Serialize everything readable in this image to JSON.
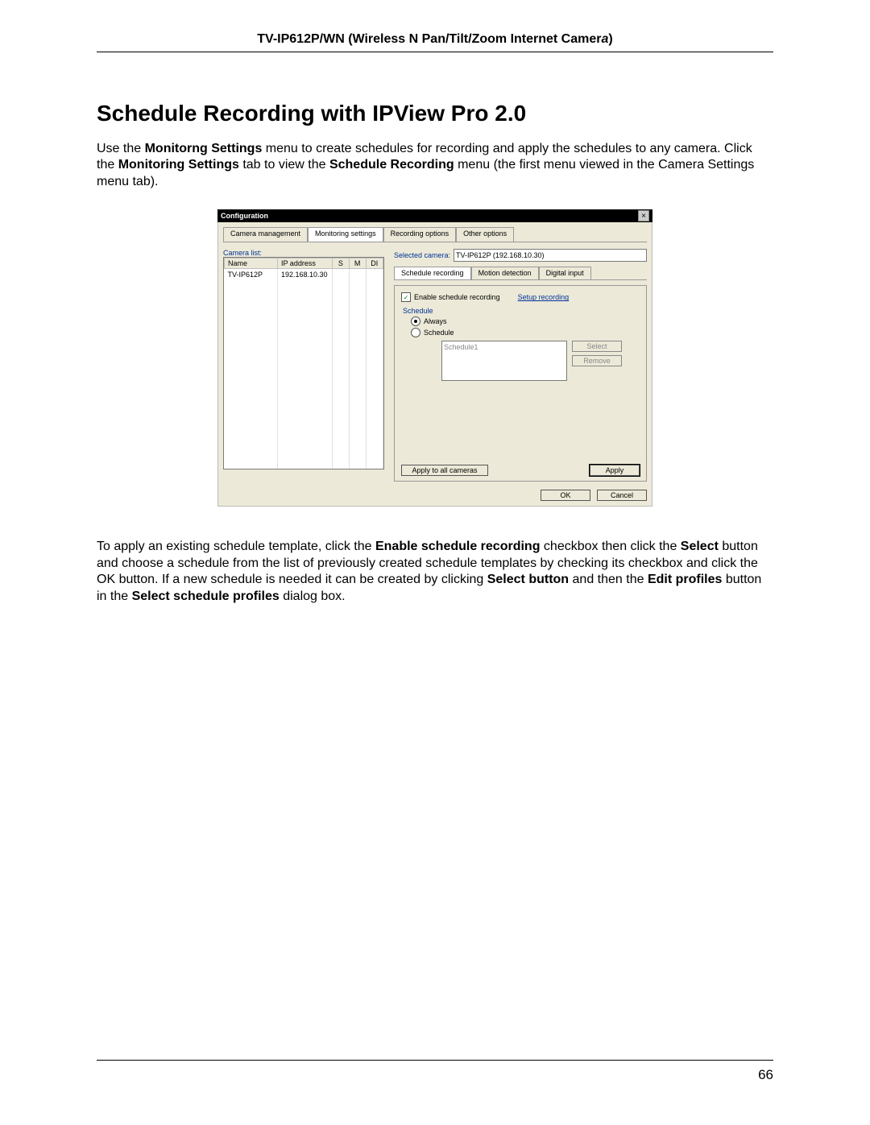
{
  "header": {
    "pre": "TV-IP612P/WN (Wireless N Pan/Tilt/Zoom Internet Camer",
    "ital": "a",
    "post": ")"
  },
  "section_title": "Schedule Recording with IPView Pro 2.0",
  "para1": {
    "a": "Use the ",
    "b": "Monitorng Settings",
    "c": " menu to create schedules for recording and apply the schedules to any camera. Click the ",
    "d": "Monitoring Settings",
    "e": " tab to view the ",
    "f": "Schedule Recording",
    "g": " menu (the first menu viewed in the Camera Settings menu tab)."
  },
  "para2": {
    "a": "To apply an existing schedule template, click the ",
    "b": "Enable schedule recording",
    "c": " checkbox then click the ",
    "d": "Select",
    "e": " button and choose a schedule from the list of previously created schedule templates by checking its checkbox and click the OK button.  If a new schedule is needed it can be created by clicking ",
    "f": "Select button",
    "g": " and then the ",
    "h": "Edit profiles",
    "i": " button in the ",
    "j": "Select schedule profiles",
    "k": " dialog box."
  },
  "dialog": {
    "title": "Configuration",
    "close": "×",
    "tabs": [
      "Camera management",
      "Monitoring settings",
      "Recording options",
      "Other options"
    ],
    "camera_list_label": "Camera list:",
    "cols": {
      "name": "Name",
      "ip": "IP address",
      "s": "S",
      "m": "M",
      "di": "DI"
    },
    "camera_row": {
      "name": "TV-IP612P",
      "ip": "192.168.10.30"
    },
    "selected_camera_label": "Selected camera:",
    "selected_camera_value": "TV-IP612P (192.168.10.30)",
    "subtabs": [
      "Schedule recording",
      "Motion detection",
      "Digital input"
    ],
    "checkbox_label": "Enable schedule recording",
    "checkbox_checked": "✓",
    "setup_link": "Setup recording",
    "schedule_label": "Schedule",
    "radio_always": "Always",
    "radio_schedule": "Schedule",
    "schedule_item": "Schedule1",
    "btn_select": "Select",
    "btn_remove": "Remove",
    "btn_apply_all": "Apply to all cameras",
    "btn_apply": "Apply",
    "btn_ok": "OK",
    "btn_cancel": "Cancel"
  },
  "page_number": "66"
}
